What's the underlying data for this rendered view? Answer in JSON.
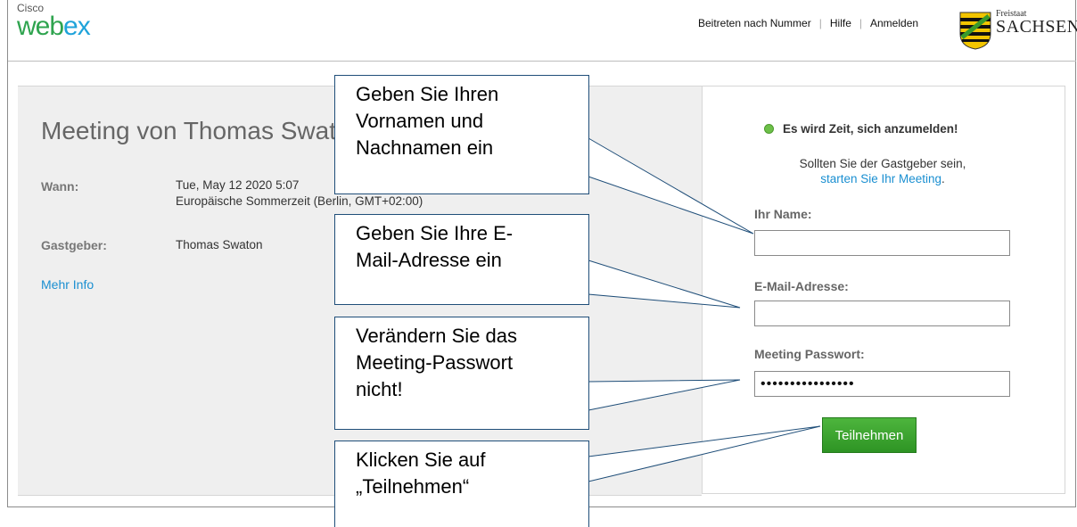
{
  "header": {
    "logo_small": "Cisco",
    "logo_part1": "web",
    "logo_part2": "ex",
    "nav": [
      "Beitreten nach Nummer",
      "Hilfe",
      "Anmelden"
    ],
    "partner_small": "Freistaat",
    "partner_name": "SACHSEN"
  },
  "meeting": {
    "title": "Meeting von Thomas Swaton",
    "when_label": "Wann:",
    "when_line1": "Tue, May 12 2020 5:07",
    "when_line2": "Europäische Sommerzeit (Berlin, GMT+02:00)",
    "host_label": "Gastgeber:",
    "host_value": "Thomas Swaton",
    "more_info": "Mehr Info"
  },
  "join_panel": {
    "status": "Es wird Zeit, sich anzumelden!",
    "host_hint": "Sollten Sie der Gastgeber sein,",
    "host_link": "starten Sie Ihr Meeting",
    "host_link_suffix": ".",
    "name_label": "Ihr Name:",
    "name_value": "",
    "email_label": "E-Mail-Adresse:",
    "email_value": "",
    "password_label": "Meeting Passwort:",
    "password_value": "••••••••••••••••",
    "join_button": "Teilnehmen"
  },
  "callouts": {
    "name": [
      "Geben Sie Ihren",
      "Vornamen und",
      "Nachnamen ein"
    ],
    "email": [
      "Geben Sie Ihre E-",
      "Mail-Adresse ein"
    ],
    "password": [
      "Verändern Sie das",
      "Meeting-Passwort",
      "nicht!"
    ],
    "join": [
      "Klicken Sie auf",
      "„Teilnehmen“"
    ]
  },
  "colors": {
    "brand_green": "#2fa44f",
    "brand_blue": "#1fa3da",
    "link": "#1a8fd1",
    "button": "#3aa52f",
    "callout_border": "#1f4e79"
  }
}
